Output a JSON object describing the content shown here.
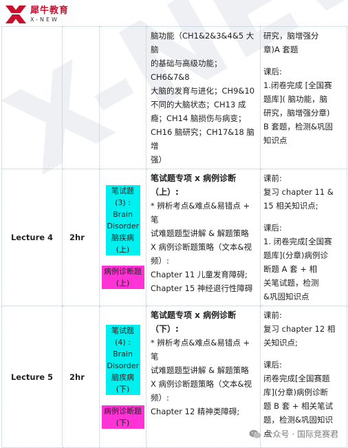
{
  "logo": {
    "brand_cn": "犀牛教育",
    "brand_en": "X-NEW"
  },
  "watermark": "X-NEW",
  "rows": [
    {
      "lecture": "",
      "hours": "",
      "tags": [],
      "desc_title_lines": [],
      "desc_lines": [
        "脑功能（CH1&2&3&4&5 大脑",
        "的基础与高级功能；CH6&7&8",
        "大脑的发育与进化；CH9&10",
        "不同的大脑状态；CH13 成",
        "瘾；CH14 脑损伤与病变；",
        "CH16 脑研究；CH17&18 脑增",
        "强）"
      ],
      "plan_before_label": "",
      "plan_before_lines": [
        "研究，脑增强分",
        "章)A 套题"
      ],
      "plan_after_label": "课后:",
      "plan_after_lines": [
        "1.闭卷完成 [全国赛",
        "题库]( 脑功能，脑",
        "研究，脑增强分章)",
        "B 套题，检测&巩固",
        "知识点"
      ]
    },
    {
      "lecture": "Lecture 4",
      "hours": "2hr",
      "tags": [
        {
          "kind": "cyan",
          "lines": [
            "笔试题",
            "(3) :",
            "Brain",
            "Disorder",
            "脑疾病",
            "(上)"
          ]
        },
        {
          "kind": "magenta",
          "lines": [
            "病例诊断题",
            "(上)"
          ]
        }
      ],
      "desc_title_lines": [
        "笔试题专项 x 病例诊断",
        "（上）:"
      ],
      "desc_lines": [
        "* 辨析考点&难点&易错点 + 笔",
        "试难题题型讲解 & 解题策略",
        "X 病例诊断题策略（文本&视",
        "频）:",
        "Chapter 11 儿童发育障碍;",
        "Chapter 15 神经退行性障碍"
      ],
      "plan_before_label": "课前:",
      "plan_before_lines": [
        "复习 chapter 11 &",
        "15 相关知识点;"
      ],
      "plan_after_label": "课后:",
      "plan_after_lines": [
        "1. 闭卷完成[全国赛",
        "题库](分章)病例诊",
        "断题 A 套 + 相",
        "关笔试题，检测",
        "&巩固知识点"
      ]
    },
    {
      "lecture": "Lecture 5",
      "hours": "2hr",
      "tags": [
        {
          "kind": "cyan",
          "lines": [
            "笔试题",
            "(4) :",
            "Brain",
            "Disorder",
            "脑疾病",
            "(下)"
          ]
        },
        {
          "kind": "magenta",
          "lines": [
            "病例诊断题",
            "(下)"
          ]
        }
      ],
      "desc_title_lines": [
        "笔试题专项 x 病例诊断",
        "（下）:"
      ],
      "desc_lines": [
        "* 辨析考点&难点&易错点 + 笔",
        "试难题题型讲解 & 解题策略",
        "X 病例诊断题策略（文本&视",
        "频）:",
        "Chapter 12 精神类障碍;"
      ],
      "plan_before_label": "课前:",
      "plan_before_lines": [
        "复习 chapter 12 相",
        "关知识点;"
      ],
      "plan_after_label": "课后:",
      "plan_after_lines": [
        "闭卷完成[全国赛题",
        "库](分章)病例诊断",
        "题 B 套 + 相关笔试",
        "题，检测&巩固知识",
        "点"
      ]
    }
  ],
  "footer": {
    "text": "公众号 · 国际竞赛君"
  },
  "colors": {
    "cyan": "#00f0f0",
    "magenta": "#ff33d6",
    "brand_red": "#c8102e"
  }
}
